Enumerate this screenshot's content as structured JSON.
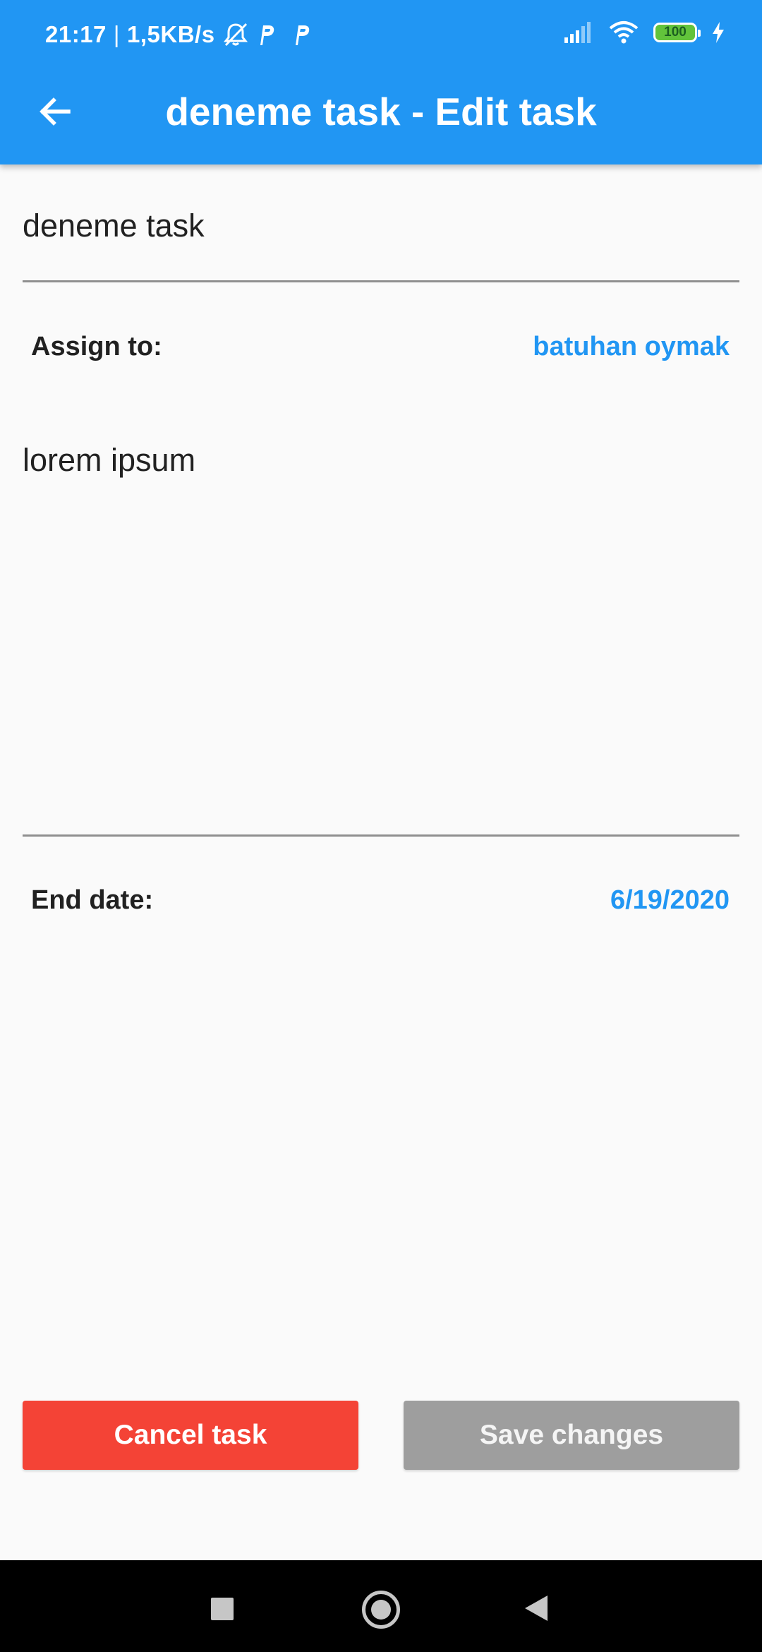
{
  "status_bar": {
    "time": "21:17",
    "separator": "|",
    "network_speed": "1,5KB/s",
    "battery_level": "100",
    "icons": [
      "mute-icon",
      "p-app-icon",
      "p-app-icon",
      "signal-icon",
      "wifi-icon",
      "battery-icon",
      "charging-icon"
    ]
  },
  "app_bar": {
    "title": "deneme task - Edit task",
    "back_icon": "arrow-left-icon",
    "color": "#2196f3"
  },
  "form": {
    "task_name": "deneme task",
    "assign_label": "Assign to:",
    "assignee": "batuhan oymak",
    "description": "lorem ipsum",
    "end_date_label": "End date:",
    "end_date": "6/19/2020"
  },
  "actions": {
    "cancel_label": "Cancel task",
    "save_label": "Save changes",
    "cancel_color": "#f44336",
    "save_color": "#9e9e9e"
  },
  "nav_bar": {
    "icons": [
      "recent-apps-icon",
      "home-icon",
      "back-icon"
    ]
  }
}
